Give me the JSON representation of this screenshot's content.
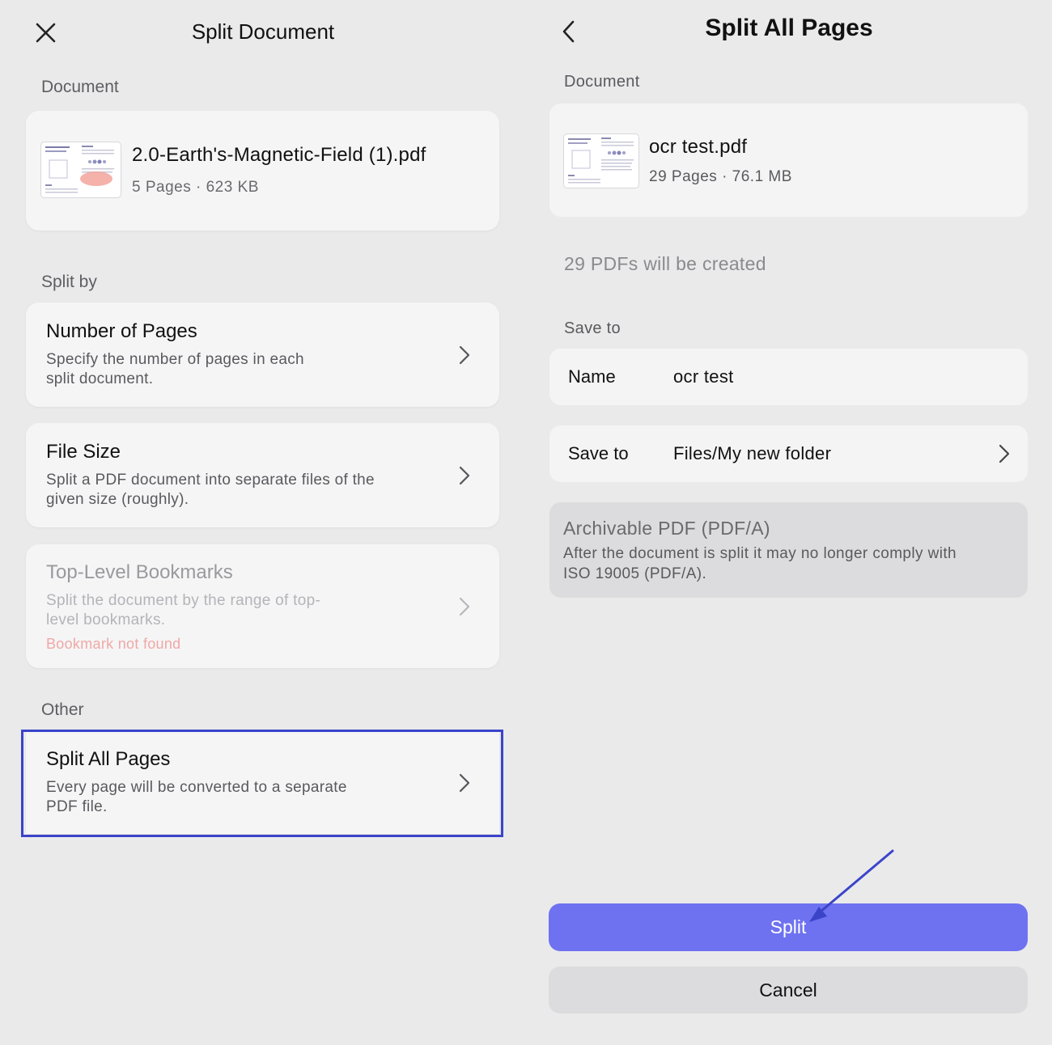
{
  "left": {
    "title": "Split Document",
    "document_label": "Document",
    "document": {
      "name": "2.0-Earth's-Magnetic-Field (1).pdf",
      "meta": "5 Pages · 623 KB"
    },
    "split_by_label": "Split by",
    "options": [
      {
        "title": "Number of Pages",
        "desc_line1": "Specify the number of pages in each",
        "desc_line2": "split document."
      },
      {
        "title": "File Size",
        "desc_line1": "Split a PDF document into separate files of the",
        "desc_line2": "given size (roughly)."
      },
      {
        "title": "Top-Level Bookmarks",
        "desc_line1": "Split the document by the range of top-",
        "desc_line2": "level bookmarks.",
        "warning": "Bookmark not found"
      }
    ],
    "other_label": "Other",
    "other_option": {
      "title": "Split All Pages",
      "desc_line1": "Every page will be converted to a separate",
      "desc_line2": "PDF file."
    }
  },
  "right": {
    "title": "Split All Pages",
    "document_label": "Document",
    "document": {
      "name": "ocr test.pdf",
      "meta": "29 Pages · 76.1 MB"
    },
    "created_text": "29 PDFs will be created",
    "save_to_label": "Save to",
    "name_key": "Name",
    "name_value": "ocr test",
    "save_to_key": "Save to",
    "save_to_value": "Files/My new folder",
    "archivable_title": "Archivable PDF (PDF/A)",
    "archivable_desc_line1": "After the document is split it may no longer comply with",
    "archivable_desc_line2": "ISO 19005 (PDF/A).",
    "split_label": "Split",
    "cancel_label": "Cancel"
  },
  "colors": {
    "accent": "#6e72f0",
    "highlight": "#3b44c9",
    "warning": "#f0a8a6",
    "background": "#eaeaeb"
  },
  "icons": [
    "close-icon",
    "back-chevron-icon",
    "chevron-right-icon",
    "annotation-arrow-icon"
  ]
}
